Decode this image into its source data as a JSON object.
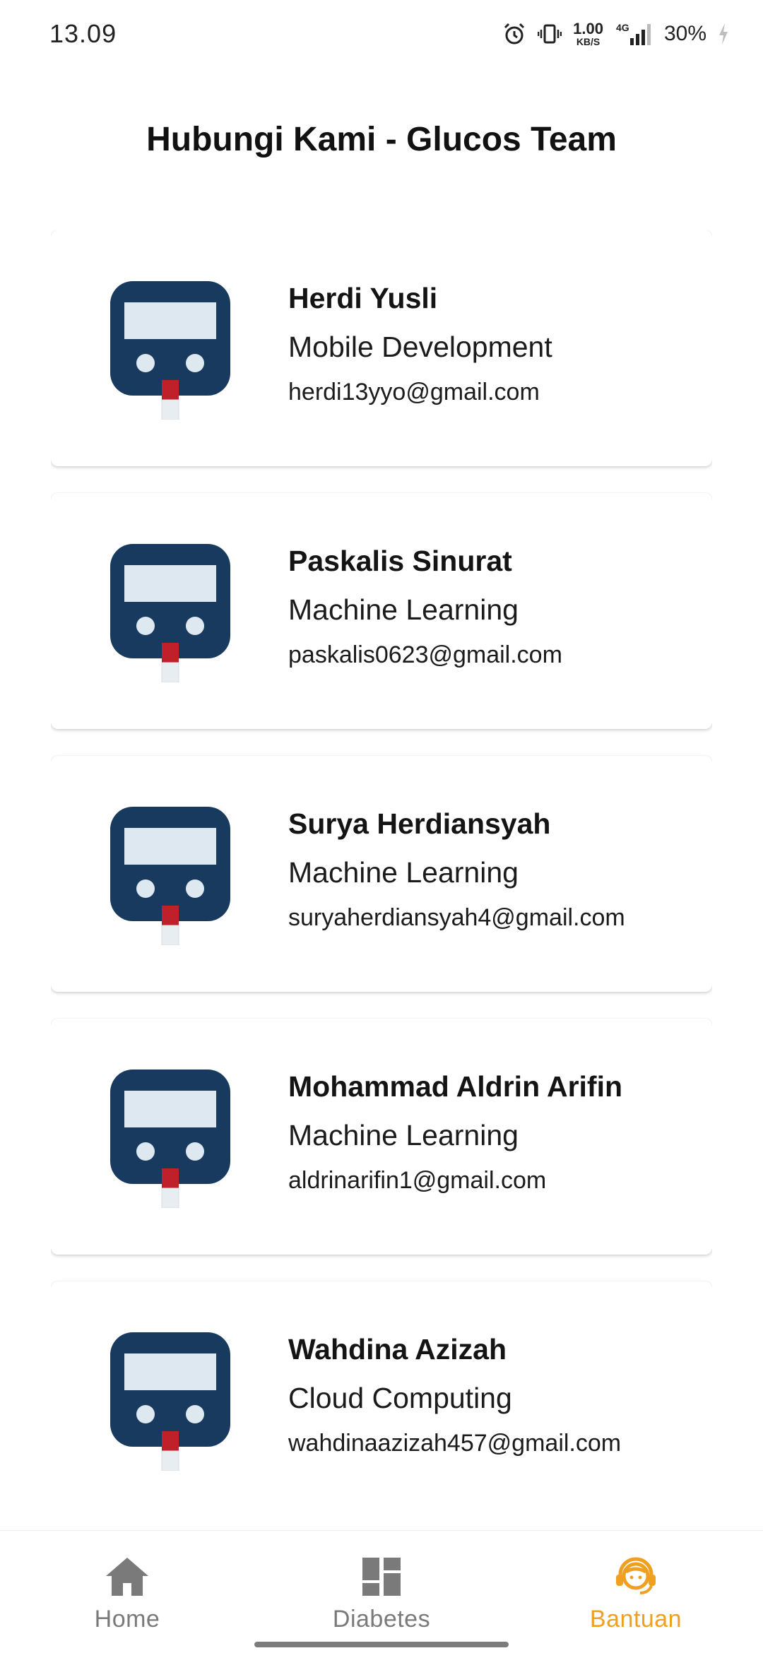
{
  "status_bar": {
    "time": "13.09",
    "speed_value": "1.00",
    "speed_unit": "KB/S",
    "network": "4G",
    "battery": "30%"
  },
  "page": {
    "title": "Hubungi Kami - Glucos Team"
  },
  "contacts": [
    {
      "name": "Herdi Yusli",
      "role": "Mobile Development",
      "email": "herdi13yyo@gmail.com"
    },
    {
      "name": "Paskalis Sinurat",
      "role": "Machine Learning",
      "email": "paskalis0623@gmail.com"
    },
    {
      "name": "Surya Herdiansyah",
      "role": "Machine Learning",
      "email": "suryaherdiansyah4@gmail.com"
    },
    {
      "name": "Mohammad Aldrin Arifin",
      "role": "Machine Learning",
      "email": "aldrinarifin1@gmail.com"
    },
    {
      "name": "Wahdina Azizah",
      "role": "Cloud Computing",
      "email": "wahdinaazizah457@gmail.com"
    }
  ],
  "bottom_nav": {
    "items": [
      {
        "label": "Home",
        "icon": "home-icon",
        "active": false
      },
      {
        "label": "Diabetes",
        "icon": "dashboard-icon",
        "active": false
      },
      {
        "label": "Bantuan",
        "icon": "support-agent-icon",
        "active": true
      }
    ]
  },
  "colors": {
    "accent": "#f0a020",
    "nav_inactive": "#7a7a7a",
    "glucometer_body": "#173a5e",
    "glucometer_screen": "#dde8f0",
    "test_strip_tip": "#c0202a"
  }
}
